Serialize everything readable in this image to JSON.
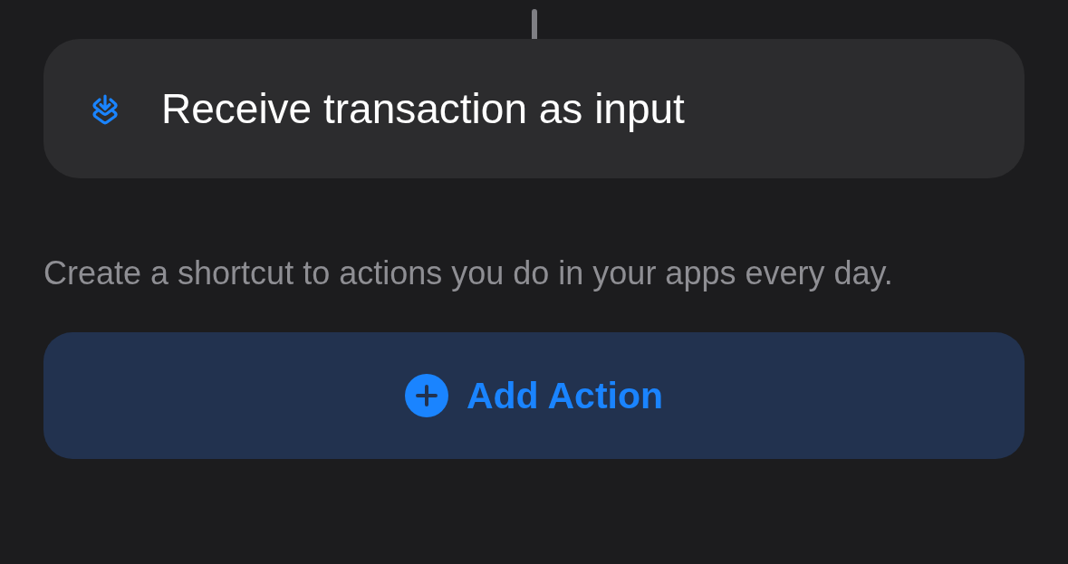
{
  "action_card": {
    "label": "Receive transaction as input"
  },
  "description": "Create a shortcut to actions you do in your apps every day.",
  "add_button": {
    "label": "Add Action"
  }
}
